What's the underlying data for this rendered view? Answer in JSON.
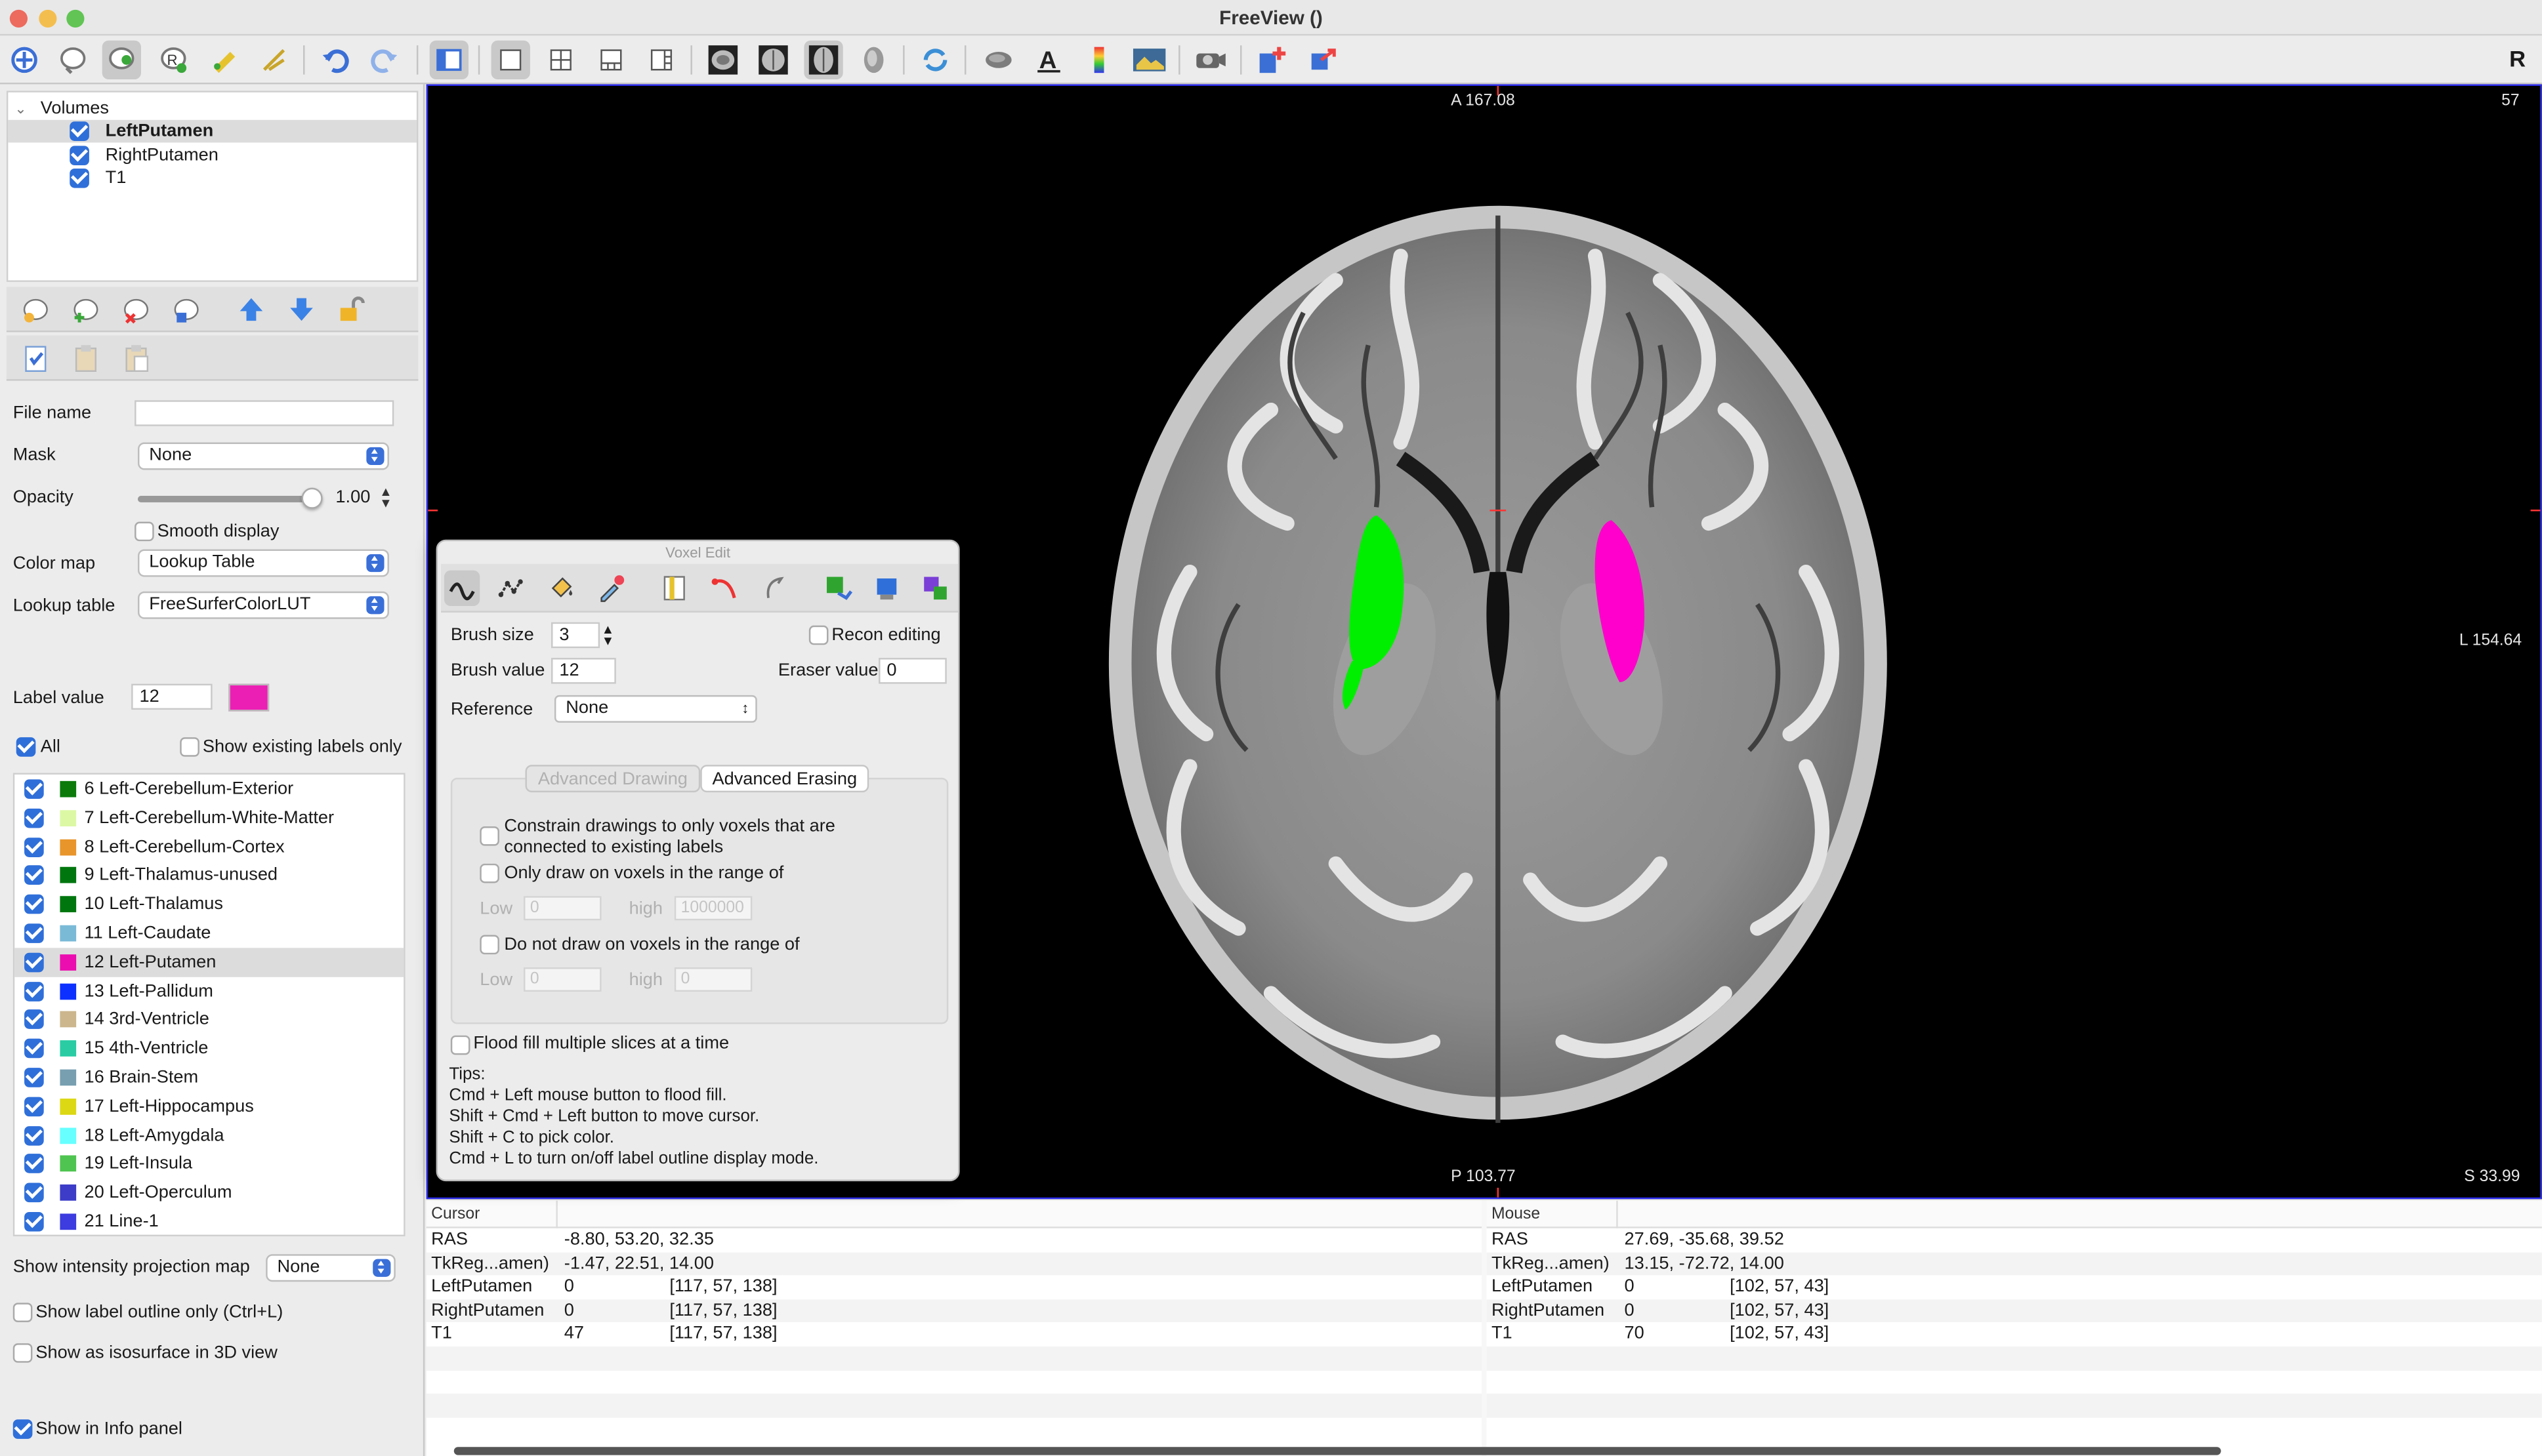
{
  "window": {
    "title": "FreeView ()"
  },
  "toolbar": {
    "right_label": "R",
    "icons": [
      "navigate",
      "recon-edit",
      "voxel-edit",
      "roi-edit",
      "point-set-edit",
      "contour",
      "undo",
      "redo",
      "toggle-panel",
      "layout-1x1",
      "layout-2x2",
      "layout-1-3",
      "layout-1-3h",
      "view-sagittal",
      "view-coronal",
      "view-axial",
      "view-3d",
      "reset-view",
      "surface",
      "text",
      "colorbar",
      "screenshot",
      "camera",
      "sync-plus",
      "sync-arrow"
    ]
  },
  "layers": {
    "group_label": "Volumes",
    "items": [
      {
        "label": "LeftPutamen",
        "checked": true,
        "selected": true
      },
      {
        "label": "RightPutamen",
        "checked": true
      },
      {
        "label": "T1",
        "checked": true
      }
    ]
  },
  "props": {
    "file_name_label": "File name",
    "file_name_value": "",
    "mask_label": "Mask",
    "mask_value": "None",
    "opacity_label": "Opacity",
    "opacity_value": "1.00",
    "opacity_level": 1.0,
    "smooth_label": "Smooth display",
    "colormap_label": "Color map",
    "colormap_value": "Lookup Table",
    "lut_label": "Lookup table",
    "lut_value": "FreeSurferColorLUT",
    "label_value_label": "Label value",
    "label_value": "12",
    "label_color": "#ec1fb5",
    "all_label": "All",
    "show_existing_label": "Show existing labels only",
    "proj_label": "Show intensity projection map",
    "proj_value": "None",
    "outline_label": "Show label outline only (Ctrl+L)",
    "iso_label": "Show as isosurface in 3D view",
    "info_label": "Show in Info panel"
  },
  "labels": [
    {
      "text": "6 Left-Cerebellum-Exterior",
      "color": "#0b7a0b"
    },
    {
      "text": "7 Left-Cerebellum-White-Matter",
      "color": "#dcf8a4"
    },
    {
      "text": "8 Left-Cerebellum-Cortex",
      "color": "#e8952b"
    },
    {
      "text": "9 Left-Thalamus-unused",
      "color": "#00760e"
    },
    {
      "text": "10 Left-Thalamus",
      "color": "#00760e"
    },
    {
      "text": "11 Left-Caudate",
      "color": "#7abad7"
    },
    {
      "text": "12 Left-Putamen",
      "color": "#ec0db0",
      "selected": true
    },
    {
      "text": "13 Left-Pallidum",
      "color": "#0c30ff"
    },
    {
      "text": "14 3rd-Ventricle",
      "color": "#cbb68e"
    },
    {
      "text": "15 4th-Ventricle",
      "color": "#2acca4"
    },
    {
      "text": "16 Brain-Stem",
      "color": "#779fb0"
    },
    {
      "text": "17 Left-Hippocampus",
      "color": "#dcd814"
    },
    {
      "text": "18 Left-Amygdala",
      "color": "#67ffff"
    },
    {
      "text": "19 Left-Insula",
      "color": "#50c450"
    },
    {
      "text": "20 Left-Operculum",
      "color": "#3c3cc8"
    },
    {
      "text": "21 Line-1",
      "color": "#3c3ce0"
    }
  ],
  "viewport": {
    "top": "A 167.08",
    "bottom": "P 103.77",
    "right": "L 154.64",
    "slice": "57",
    "bottom_right": "S 33.99"
  },
  "voxel_edit": {
    "title": "Voxel Edit",
    "brush_size_label": "Brush size",
    "brush_size": "3",
    "recon_label": "Recon editing",
    "brush_value_label": "Brush value",
    "brush_value": "12",
    "eraser_label": "Eraser value",
    "eraser_value": "0",
    "reference_label": "Reference",
    "reference_value": "None",
    "tab_drawing": "Advanced Drawing",
    "tab_erasing": "Advanced Erasing",
    "constrain_label": "Constrain drawings to only voxels that are connected to existing labels",
    "range_label": "Only draw on voxels in the range of",
    "not_range_label": "Do not draw on voxels in the range of",
    "low_label": "Low",
    "high_label": "high",
    "low1": "0",
    "high1": "1000000",
    "low2": "0",
    "high2": "0",
    "flood_label": "Flood fill multiple slices at a time",
    "tips_title": "Tips:",
    "tips": [
      "Cmd + Left mouse button to flood fill.",
      "Shift + Cmd + Left button to move cursor.",
      "Shift + C to pick color.",
      "Cmd + L to turn on/off label outline display mode."
    ]
  },
  "info": {
    "cursor": {
      "header": "Cursor",
      "rows": [
        [
          "RAS",
          "-8.80, 53.20, 32.35",
          ""
        ],
        [
          "TkReg...amen)",
          "-1.47, 22.51, 14.00",
          ""
        ],
        [
          "LeftPutamen",
          "0",
          "[117, 57, 138]"
        ],
        [
          "RightPutamen",
          "0",
          "[117, 57, 138]"
        ],
        [
          "T1",
          "47",
          "[117, 57, 138]"
        ]
      ]
    },
    "mouse": {
      "header": "Mouse",
      "rows": [
        [
          "RAS",
          "27.69, -35.68, 39.52",
          ""
        ],
        [
          "TkReg...amen)",
          "13.15, -72.72, 14.00",
          ""
        ],
        [
          "LeftPutamen",
          "0",
          "[102, 57, 43]"
        ],
        [
          "RightPutamen",
          "0",
          "[102, 57, 43]"
        ],
        [
          "T1",
          "70",
          "[102, 57, 43]"
        ]
      ]
    }
  }
}
